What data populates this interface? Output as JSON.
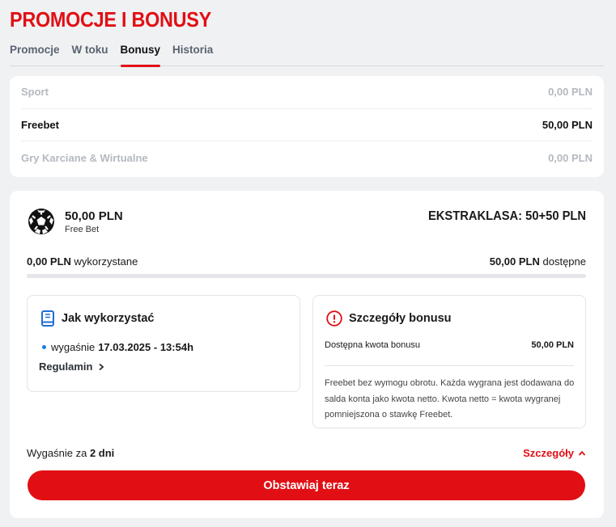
{
  "page": {
    "title": "PROMOCJE I BONUSY"
  },
  "tabs": [
    {
      "label": "Promocje",
      "active": false
    },
    {
      "label": "W toku",
      "active": false
    },
    {
      "label": "Bonusy",
      "active": true
    },
    {
      "label": "Historia",
      "active": false
    }
  ],
  "balances": [
    {
      "label": "Sport",
      "value": "0,00 PLN",
      "active": false
    },
    {
      "label": "Freebet",
      "value": "50,00 PLN",
      "active": true
    },
    {
      "label": "Gry Karciane & Wirtualne",
      "value": "0,00 PLN",
      "active": false
    }
  ],
  "bonus": {
    "icon": "soccer-ball-icon",
    "amount": "50,00 PLN",
    "type": "Free Bet",
    "name": "EKSTRAKLASA: 50+50 PLN",
    "used_value": "0,00 PLN",
    "used_label": "wykorzystane",
    "available_value": "50,00 PLN",
    "available_label": "dostępne",
    "progress_fraction": 0,
    "how_to": {
      "icon": "book-icon",
      "title": "Jak wykorzystać",
      "expiry_label": "wygaśnie",
      "expiry_value": "17.03.2025 - 13:54h",
      "terms_label": "Regulamin"
    },
    "details": {
      "icon": "info-icon",
      "title": "Szczegóły bonusu",
      "row_label": "Dostępna kwota bonusu",
      "row_value": "50,00 PLN",
      "description": "Freebet bez wymogu obrotu. Każda wygrana jest dodawana do salda konta jako kwota netto. Kwota netto = kwota wygranej pomniejszona o stawkę Freebet."
    },
    "expires_in_label": "Wygaśnie za",
    "expires_in_value": "2 dni",
    "details_toggle_label": "Szczegóły",
    "cta_label": "Obstawiaj teraz"
  },
  "colors": {
    "accent": "#e10f14",
    "dot": "#1f7ae0",
    "book": "#1f6fd6"
  }
}
